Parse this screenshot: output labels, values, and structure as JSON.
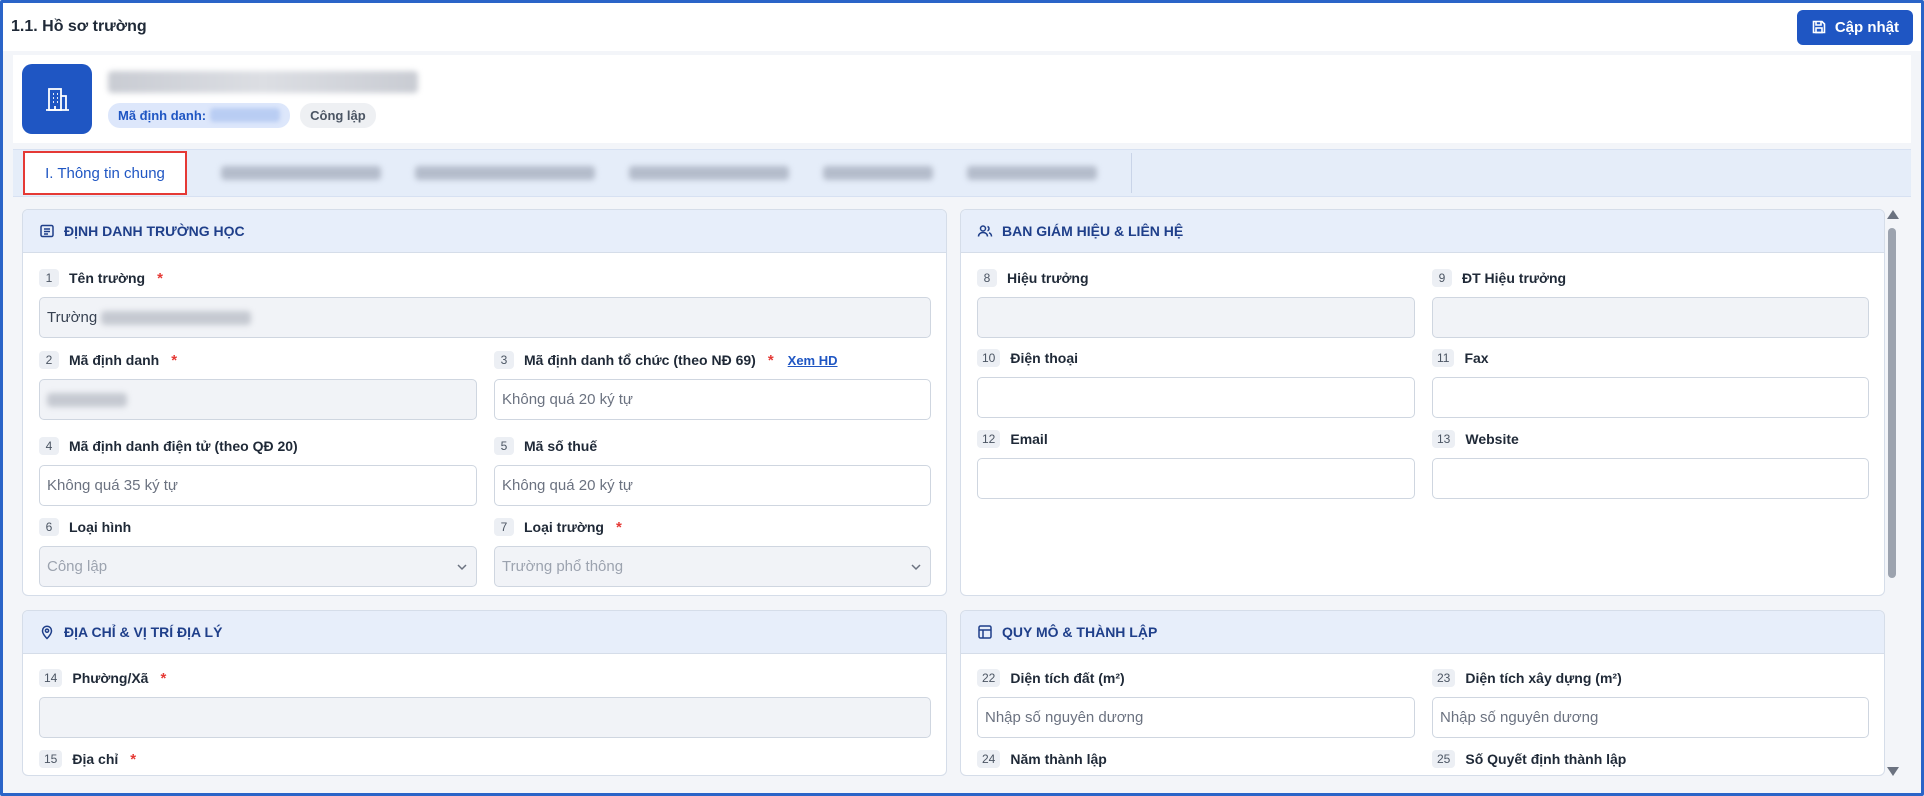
{
  "header": {
    "title": "1.1. Hồ sơ trường",
    "update_label": "Cập nhật"
  },
  "profile": {
    "id_label": "Mã định danh:",
    "school_type": "Công lập"
  },
  "tabs": {
    "active": "I. Thông tin chung"
  },
  "sections": {
    "identity": {
      "title": "ĐỊNH DANH TRƯỜNG HỌC",
      "fields": {
        "f1": {
          "num": "1",
          "label": "Tên trường",
          "value_prefix": "Trường"
        },
        "f2": {
          "num": "2",
          "label": "Mã định danh"
        },
        "f3": {
          "num": "3",
          "label": "Mã định danh tổ chức (theo NĐ 69)",
          "link": "Xem HD",
          "placeholder": "Không quá 20 ký tự"
        },
        "f4": {
          "num": "4",
          "label": "Mã định danh điện tử (theo QĐ 20)",
          "placeholder": "Không quá 35 ký tự"
        },
        "f5": {
          "num": "5",
          "label": "Mã số thuế",
          "placeholder": "Không quá 20 ký tự"
        },
        "f6": {
          "num": "6",
          "label": "Loại hình",
          "value": "Công lập"
        },
        "f7": {
          "num": "7",
          "label": "Loại trường",
          "value": "Trường phổ thông"
        }
      }
    },
    "leadership": {
      "title": "BAN GIÁM HIỆU & LIÊN HỆ",
      "fields": {
        "f8": {
          "num": "8",
          "label": "Hiệu trưởng"
        },
        "f9": {
          "num": "9",
          "label": "ĐT Hiệu trưởng"
        },
        "f10": {
          "num": "10",
          "label": "Điện thoại"
        },
        "f11": {
          "num": "11",
          "label": "Fax"
        },
        "f12": {
          "num": "12",
          "label": "Email"
        },
        "f13": {
          "num": "13",
          "label": "Website"
        }
      }
    },
    "address": {
      "title": "ĐỊA CHỈ & VỊ TRÍ ĐỊA LÝ",
      "fields": {
        "f14": {
          "num": "14",
          "label": "Phường/Xã"
        },
        "f15": {
          "num": "15",
          "label": "Địa chỉ"
        }
      }
    },
    "scale": {
      "title": "QUY MÔ & THÀNH LẬP",
      "fields": {
        "f22": {
          "num": "22",
          "label": "Diện tích đất (m²)",
          "placeholder": "Nhập số nguyên dương"
        },
        "f23": {
          "num": "23",
          "label": "Diện tích xây dựng (m²)",
          "placeholder": "Nhập số nguyên dương"
        },
        "f24": {
          "num": "24",
          "label": "Năm thành lập"
        },
        "f25": {
          "num": "25",
          "label": "Số Quyết định thành lập"
        }
      }
    }
  },
  "colors": {
    "primary": "#1f56c3",
    "required": "#e53935",
    "section_head": "#e7eefa"
  }
}
